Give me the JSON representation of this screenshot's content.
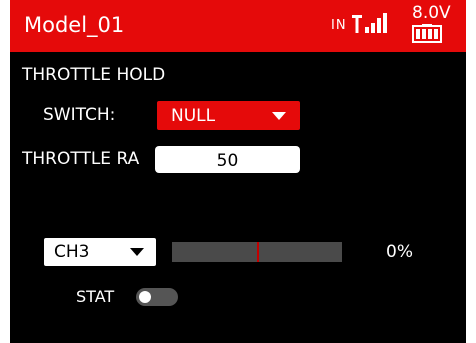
{
  "header": {
    "title": "Model_01",
    "rx_indicator": "IN",
    "signal_icon": "signal-bars-icon",
    "voltage": "8.0V",
    "battery_icon": "battery-icon"
  },
  "throttle_hold": {
    "title": "THROTTLE HOLD",
    "switch_label": "SWITCH:",
    "switch_value": "NULL",
    "rate_label": "THROTTLE RA",
    "rate_value": "50"
  },
  "monitor": {
    "channel": "CH3",
    "percent_text": "0%",
    "level_fraction": 0.0,
    "stat_label": "STAT",
    "stat_on": false
  },
  "colors": {
    "accent": "#e50a0a",
    "background": "#000000",
    "bar_track": "#4a4a4a",
    "bar_marker": "#c40000"
  }
}
